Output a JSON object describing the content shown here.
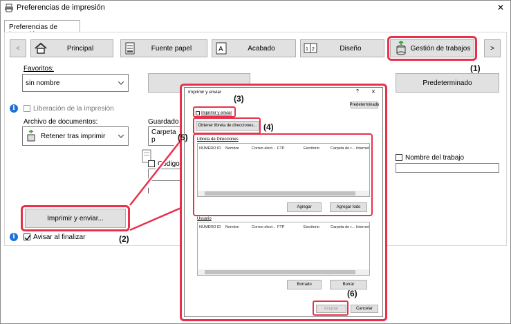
{
  "window": {
    "title": "Preferencias de impresión",
    "close": "✕"
  },
  "tab_label": "Preferencias de impresión",
  "toolbar": {
    "prev": "<",
    "next": ">",
    "tabs": [
      {
        "label": "Principal",
        "icon": "home-icon"
      },
      {
        "label": "Fuente papel",
        "icon": "paper-source-icon"
      },
      {
        "label": "Acabado",
        "icon": "finishing-icon"
      },
      {
        "label": "Diseño",
        "icon": "layout-icon"
      },
      {
        "label": "Gestión de trabajos",
        "icon": "job-management-icon"
      }
    ]
  },
  "main": {
    "favorites_label": "Favoritos:",
    "favorites_value": "sin nombre",
    "default_button": "Predeterminado",
    "print_release_label": "Liberación de la impresión",
    "archive_label": "Archivo de documentos:",
    "archive_value": "Retener tras imprimir",
    "saved_label": "Guardado e",
    "saved_value": "Carpeta p",
    "code_label": "Código",
    "job_name_label": "Nombre del trabajo",
    "print_send_button": "Imprimir y enviar...",
    "notify_label": "Avisar al finalizar"
  },
  "dialog": {
    "title": "Imprimir y enviar",
    "help": "?",
    "close": "✕",
    "default_button": "Predeterminado",
    "print_send_check": "Imprimir y enviar",
    "get_address_book": "Obtener libreta de direcciones...",
    "address_book_label": "Libreta de Direcciones",
    "columns": [
      "NÚMERO ID",
      "Nombre",
      "Correo elect...",
      "FTP",
      "Escritorio",
      "Carpeta de r...",
      "Internet"
    ],
    "add_button": "Agregar",
    "add_all_button": "Agregar todo",
    "user_label": "Usuario",
    "erase_button": "Borrado",
    "delete_button": "Borrar",
    "accept_button": "Aceptar",
    "cancel_button": "Cancelar"
  },
  "steps": [
    "(1)",
    "(2)",
    "(3)",
    "(4)",
    "(5)",
    "(6)"
  ],
  "colors": {
    "highlight": "#e8304b",
    "info": "#1e6fd9"
  }
}
